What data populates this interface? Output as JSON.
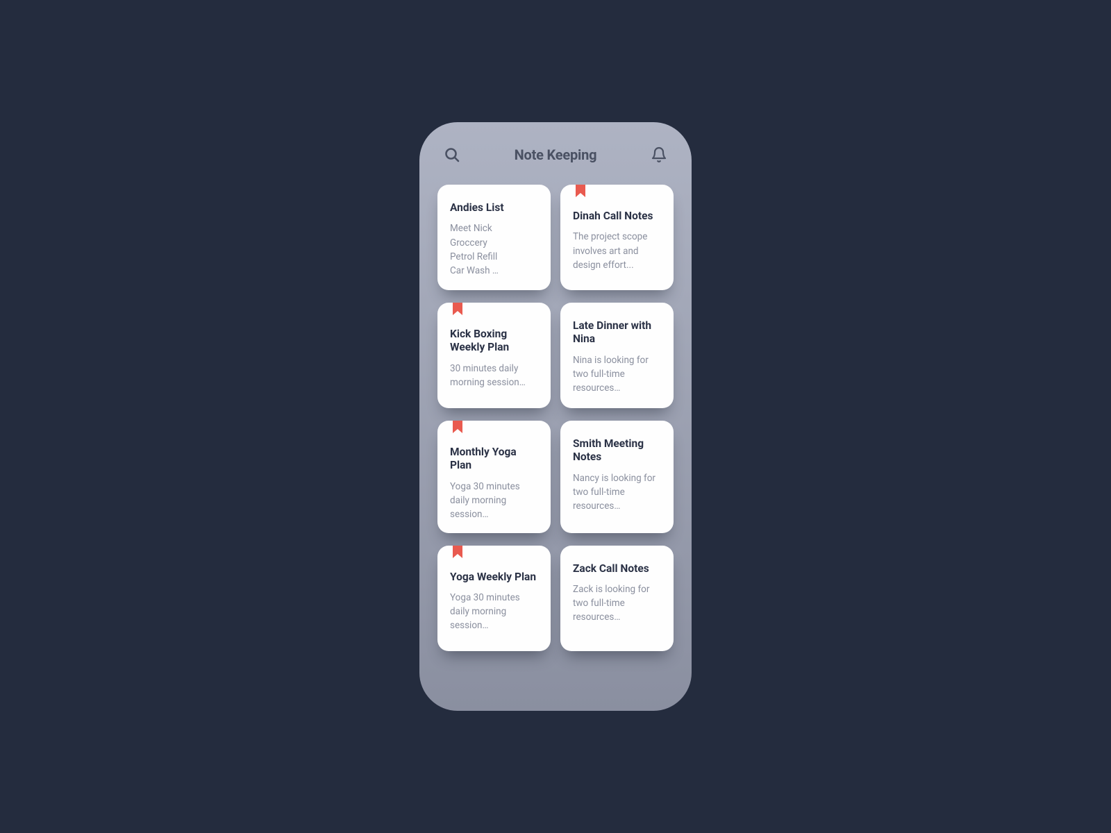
{
  "header": {
    "title": "Note Keeping"
  },
  "notes": [
    {
      "title": "Andies List",
      "bookmarked": false,
      "lines": [
        "Meet Nick",
        "Groccery",
        "Petrol Refill",
        "Car Wash …"
      ]
    },
    {
      "title": "Dinah Call Notes",
      "bookmarked": true,
      "body": "The project scope involves art and design effort..."
    },
    {
      "title": "Kick Boxing Weekly Plan",
      "bookmarked": true,
      "body": "30 minutes daily morning session…"
    },
    {
      "title": "Late Dinner with Nina",
      "bookmarked": false,
      "body": "Nina is looking for two full-time resources…"
    },
    {
      "title": "Monthly Yoga Plan",
      "bookmarked": true,
      "body": "Yoga 30 minutes daily morning session…"
    },
    {
      "title": "Smith Meeting Notes",
      "bookmarked": false,
      "body": "Nancy is looking for two full-time resources…"
    },
    {
      "title": "Yoga Weekly Plan",
      "bookmarked": true,
      "body": "Yoga 30 minutes daily morning session…"
    },
    {
      "title": "Zack Call Notes",
      "bookmarked": false,
      "body": "Zack is looking for two full-time resources…"
    }
  ],
  "colors": {
    "background": "#242c3e",
    "phone_top": "#aeb3c3",
    "phone_bottom": "#8a8fa0",
    "card_bg": "#fefefe",
    "title_color": "#2b3246",
    "body_color": "#8a8f9e",
    "bookmark": "#e95a4f",
    "header_text": "#4a5163"
  },
  "icons": {
    "search": "search-icon",
    "bell": "bell-icon",
    "bookmark": "bookmark-icon"
  }
}
